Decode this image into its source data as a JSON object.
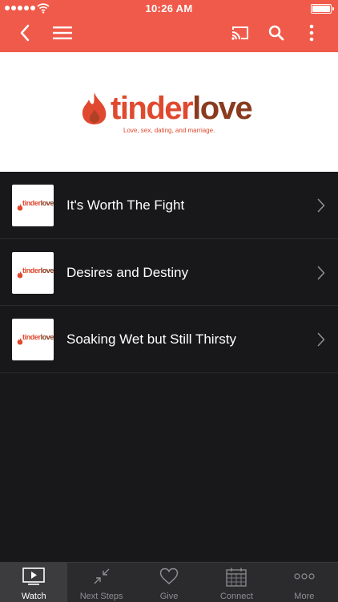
{
  "status_bar": {
    "time": "10:26 AM",
    "icons": [
      "signal-dots-icon",
      "wifi-icon",
      "battery-icon"
    ]
  },
  "navbar": {
    "icons": [
      "back-icon",
      "menu-icon",
      "cast-icon",
      "search-icon",
      "more-vertical-icon"
    ],
    "background": "#f05a4a"
  },
  "banner": {
    "logo": {
      "brand_first": "tinder",
      "brand_second": "love",
      "tagline": "Love, sex, dating, and marriage."
    }
  },
  "series": {
    "items": [
      {
        "title": "It's Worth The Fight",
        "thumb_first": "tinder",
        "thumb_second": "love"
      },
      {
        "title": "Desires and Destiny",
        "thumb_first": "tinder",
        "thumb_second": "love"
      },
      {
        "title": "Soaking Wet but Still Thirsty",
        "thumb_first": "tinder",
        "thumb_second": "love"
      }
    ]
  },
  "tabbar": {
    "tabs": [
      {
        "label": "Watch",
        "icon": "play-screen-icon",
        "active": true
      },
      {
        "label": "Next Steps",
        "icon": "arrows-in-icon",
        "active": false
      },
      {
        "label": "Give",
        "icon": "heart-icon",
        "active": false
      },
      {
        "label": "Connect",
        "icon": "calendar-icon",
        "active": false
      },
      {
        "label": "More",
        "icon": "more-dots-icon",
        "active": false
      }
    ]
  },
  "colors": {
    "accent": "#f05a4a",
    "logo_red": "#e0492f",
    "logo_brown": "#8a3a1e",
    "list_background": "#18181a",
    "tabbar_background": "#2b2b2d"
  }
}
